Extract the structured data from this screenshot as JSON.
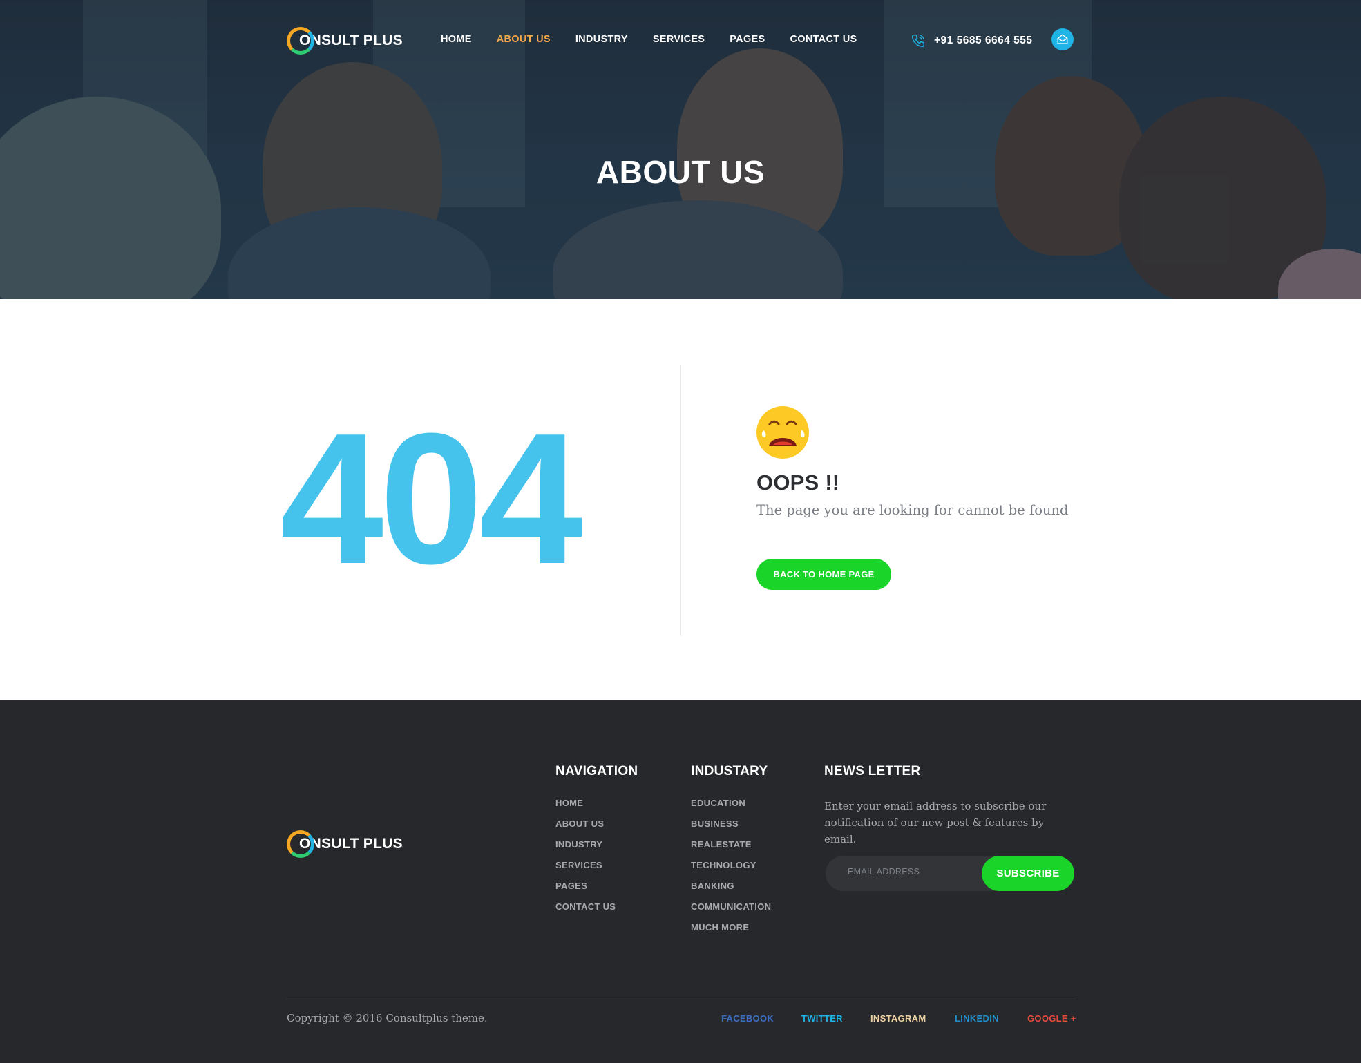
{
  "brand": {
    "name": "ONSULT PLUS",
    "colors": {
      "accent": "#1fb3e6",
      "orange": "#f5a94c",
      "green": "#1bd42a",
      "code": "#46c3ed"
    }
  },
  "nav": {
    "items": [
      "HOME",
      "ABOUT US",
      "INDUSTRY",
      "SERVICES",
      "PAGES",
      "CONTACT US"
    ],
    "active": "ABOUT US"
  },
  "contact": {
    "phone": "+91 5685 6664 555",
    "phone_icon": "phone-icon",
    "mail_icon": "mail-icon"
  },
  "hero": {
    "title": "ABOUT US"
  },
  "error": {
    "code": "404",
    "emoji": "crying-face-icon",
    "title": "OOPS !!",
    "message": "The page you are looking for cannot be found",
    "button": "BACK TO HOME PAGE"
  },
  "footer": {
    "navigation": {
      "title": "NAVIGATION",
      "items": [
        "HOME",
        "ABOUT US",
        "INDUSTRY",
        "SERVICES",
        "PAGES",
        "CONTACT US"
      ]
    },
    "industry": {
      "title": "INDUSTARY",
      "items": [
        "EDUCATION",
        "BUSINESS",
        "REALESTATE",
        "TECHNOLOGY",
        "BANKING",
        "COMMUNICATION",
        "MUCH MORE"
      ]
    },
    "newsletter": {
      "title": "NEWS LETTER",
      "text": "Enter your email address to subscribe our notification of our new post & features by email.",
      "placeholder": "EMAIL ADDRESS",
      "button": "SUBSCRIBE"
    },
    "copyright": "Copyright © 2016 Consultplus theme.",
    "social": [
      {
        "label": "FACEBOOK",
        "color": "#3b6fc0"
      },
      {
        "label": "TWITTER",
        "color": "#1fb3e6"
      },
      {
        "label": "INSTAGRAM",
        "color": "#f0d3a2"
      },
      {
        "label": "LINKEDIN",
        "color": "#1f8fd0"
      },
      {
        "label": "GOOGLE +",
        "color": "#e64a3c"
      }
    ]
  }
}
